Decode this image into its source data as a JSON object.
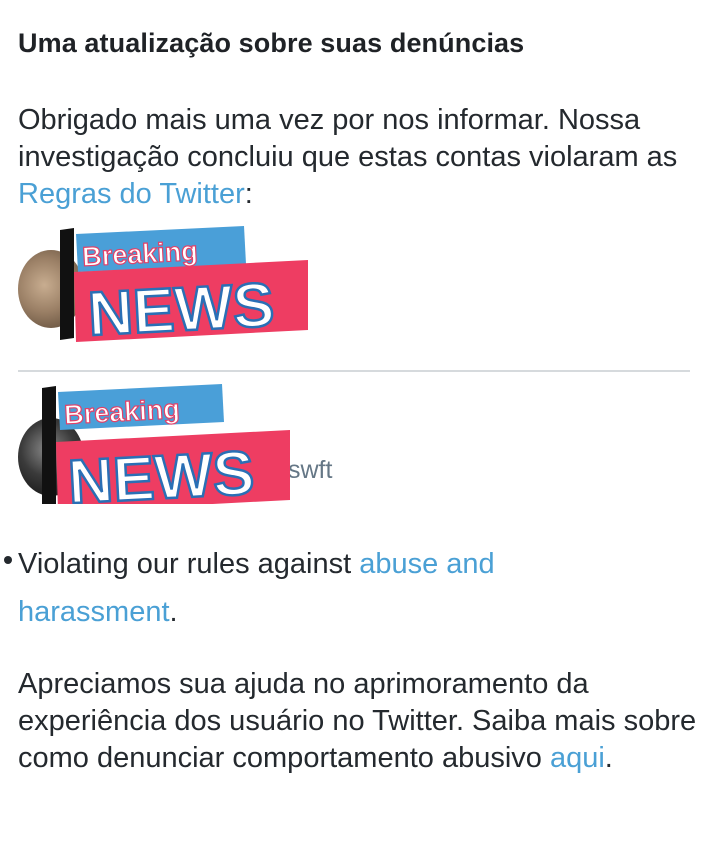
{
  "header": {
    "title": "Uma atualização sobre suas denúncias"
  },
  "intro": {
    "text_1": "Obrigado mais uma vez por nos informar. Nossa investigação concluiu que estas contas violaram as ",
    "rules_link": "Regras do Twitter",
    "text_2": ":"
  },
  "accounts": [
    {
      "sticker_top": "Breaking",
      "sticker_bottom": "NEWS"
    },
    {
      "handle_suffix": "swft",
      "sticker_top": "Breaking",
      "sticker_bottom": "NEWS"
    }
  ],
  "violation": {
    "text": "Violating our rules against ",
    "link": "abuse and harassment",
    "end": "."
  },
  "outro": {
    "text": "Apreciamos sua ajuda no aprimoramento da experiência dos usuário no Twitter. Saiba mais sobre como denunciar comportamento abusivo ",
    "link": "aqui",
    "end": "."
  },
  "colors": {
    "link": "#4aa0d5",
    "sticker_blue": "#4a9fd8",
    "sticker_red": "#ee3d62"
  }
}
